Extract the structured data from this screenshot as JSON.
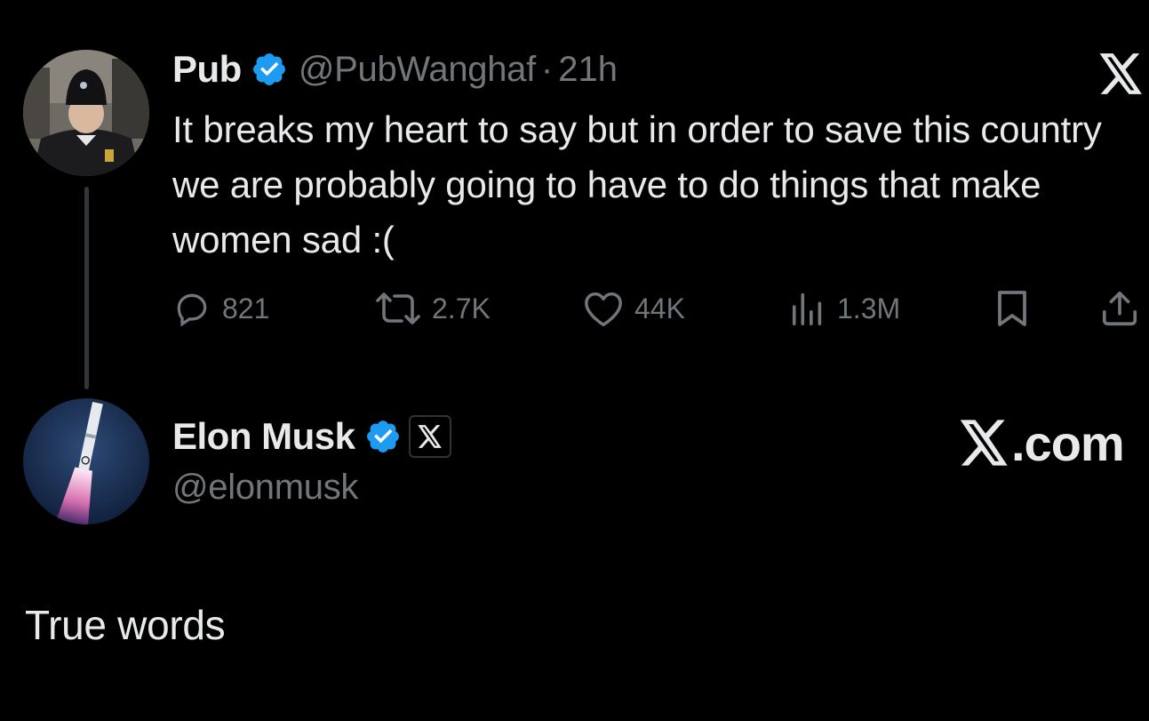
{
  "tweet": {
    "author_name": "Pub",
    "author_handle": "@PubWanghaf",
    "separator": "·",
    "time": "21h",
    "text": "It breaks my heart to say but in order to save this country we are probably going to have to do things that make women sad :(",
    "avatar_icon": "user-avatar-photo",
    "verified_icon": "verified-badge-icon",
    "platform_icon": "x-logo-icon",
    "stats": {
      "replies": "821",
      "retweets": "2.7K",
      "likes": "44K",
      "views": "1.3M"
    }
  },
  "quote": {
    "author_name": "Elon Musk",
    "author_handle": "@elonmusk",
    "brand_text": ".com",
    "avatar_icon": "rocket-avatar-photo",
    "verified_icon": "verified-badge-icon",
    "affiliation_icon": "x-affiliation-badge-icon",
    "body": "True words"
  },
  "colors": {
    "background": "#000000",
    "text_primary": "#e7e9ea",
    "text_secondary": "#71767b",
    "verified_blue": "#1d9bf0",
    "thread_line": "#333639"
  }
}
